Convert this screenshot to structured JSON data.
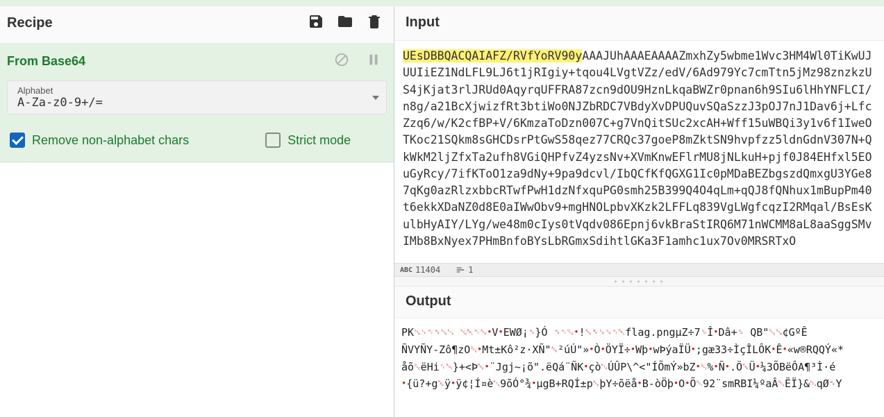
{
  "recipe": {
    "title": "Recipe",
    "operation": {
      "name": "From Base64",
      "alphabet_label": "Alphabet",
      "alphabet_value": "A-Za-z0-9+/=",
      "remove_non_alpha_label": "Remove non-alphabet chars",
      "remove_non_alpha_checked": true,
      "strict_mode_label": "Strict mode",
      "strict_mode_checked": false
    }
  },
  "icons": {
    "save": "save-icon",
    "folder": "folder-icon",
    "trash": "trash-icon",
    "disable": "disable-icon",
    "pause": "pause-icon"
  },
  "input": {
    "title": "Input",
    "highlight": "UEsDBBQACQAIAFZ/RVfYoRV90y",
    "rest": "AAAJUhAAAEAAAAZmxhZy5wbme1Wvc3HM4Wl0TiKwUJUUIiEZ1NdLFL9LJ6t1jRIgiy+tqou4LVgtVZz/edV/6Ad979Yc7cmTtn5jMz98znzkzUS4jKjat3rlJRUd0AqyrqUFFRA87zcn9dOU9HznLkqaBWZr0pnan6h9SIu6lHhYNFLCI/n8g/a21BcXjwizfRt3btiWo0NJZbRDC7VBdyXvDPUQuvSQaSzzJ3pOJ7nJ1Dav6j+LfcZzq6/w/K2cfBP+V/6KmzaToDzn007C+g7VnQitSUc2xcAH+Wff15uWBQi3y1v6f1IweOTKoc21SQkm8sGHCDsrPtGwS58qez77CRQc37goeP8mZktSN9hvpfzz5ldnGdnV307N+QkWkM2ljZfxTa2ufh8VGiQHPfvZ4yzsNv+XVmKnwEFlrMU8jNLkuH+pjf0J84EHfxl5EOuGyRcy/7ifKToO1za9dNy+9pa9dcvl/IbQCfKfQGXG1Ic0pMDaBEZbgszdQmxgU3YGe87qKg0azRlzxbbcRTwfPwH1dzNfxquPG0smh25B399Q4O4qLm+qQJ8fQNhux1mBupPm40t6ekkXDaNZ0d8E0aIWwObv9+mgHNOLpbvXKzk2LFFLq839VgLWgfcqzI2RMqal/BsEsKulbHyAIY/LYg/we48m0cIys0tVqdv086Epnj6vkBraStIRQ6M71nWCMM8aL8aaSggSMvIMb8BxNyex7PHmBnfoBYsLbRGmxSdihtlGKa3F1amhc1ux7Ov0MRSRTxO",
    "char_count": "11404",
    "line_count": "1"
  },
  "output": {
    "title": "Output",
    "lines": [
      "PK␖␊␉␈␖␂  ␖␇␉␆•V•EWØ¡␝}Ó ␝␉␐•!␆␈␍␍␉␇flag.pngµZ÷7␎Î•Dâ+␎   QB\"␐␖¢GºÊ",
      "ÑVYÑY-Zô¶zO␒•Mt±Kô²z·XÑ\"␆²úÚ\"»•Ò•ÖYÏ÷•Wþ•wÞýaÏÜ•;gæ33÷ÌçÎLÔK•Ê•«w®RQQÝ«*",
      "åõ␐ëHi␌␄}+<Þ␕•¨Jgj~¡õ\".ëQá¨ÑK•çò␃ÚÛP\\^<\"ÍÕmÝ»bZ•␓%•Ñ•.Ö␕Ü•¼3ÕBëÔA¶³Ì·é",
      "•{ü?+g␕ÿ•ÿ¢¦Í¤è␃9õÓ°¾•µgB+RQÍ±p␆þY÷õëå•B-òÖþ•O•Õ␑92¨smRBI¼ºaÂ␓ËÏ}&␔qØ␈Y"
    ]
  }
}
